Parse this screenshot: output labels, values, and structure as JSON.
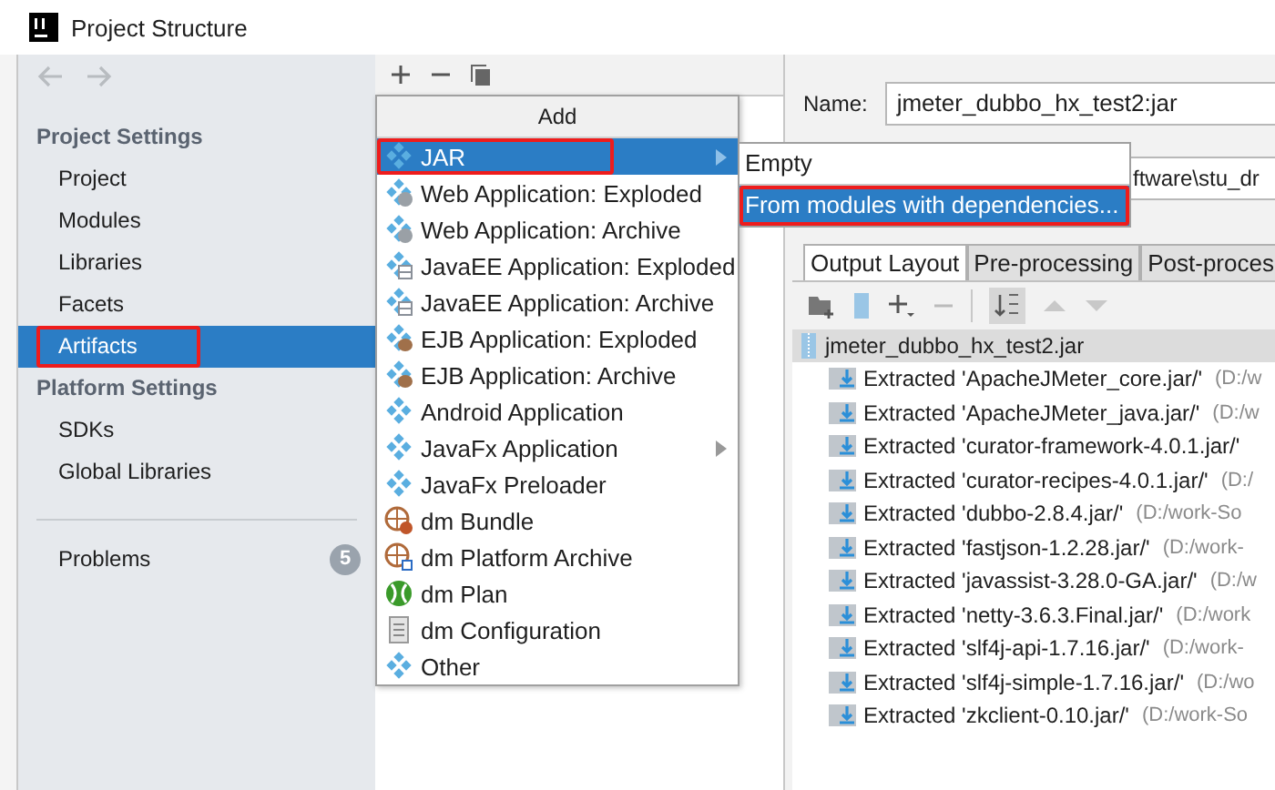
{
  "window": {
    "title": "Project Structure"
  },
  "sidebar": {
    "sections": [
      {
        "title": "Project Settings",
        "items": [
          {
            "label": "Project",
            "selected": false,
            "annotated": false
          },
          {
            "label": "Modules",
            "selected": false,
            "annotated": false
          },
          {
            "label": "Libraries",
            "selected": false,
            "annotated": false
          },
          {
            "label": "Facets",
            "selected": false,
            "annotated": false
          },
          {
            "label": "Artifacts",
            "selected": true,
            "annotated": true
          }
        ]
      },
      {
        "title": "Platform Settings",
        "items": [
          {
            "label": "SDKs",
            "selected": false,
            "annotated": false
          },
          {
            "label": "Global Libraries",
            "selected": false,
            "annotated": false
          }
        ]
      }
    ],
    "problems": {
      "label": "Problems",
      "count": "5"
    }
  },
  "add_menu": {
    "title": "Add",
    "items": [
      {
        "label": "JAR",
        "kind": "diamond",
        "selected": true,
        "submenu": true,
        "annotated": true
      },
      {
        "label": "Web Application: Exploded",
        "kind": "web",
        "selected": false,
        "submenu": false,
        "annotated": false
      },
      {
        "label": "Web Application: Archive",
        "kind": "web",
        "selected": false,
        "submenu": false,
        "annotated": false
      },
      {
        "label": "JavaEE Application: Exploded",
        "kind": "javaee",
        "selected": false,
        "submenu": false,
        "annotated": false
      },
      {
        "label": "JavaEE Application: Archive",
        "kind": "javaee",
        "selected": false,
        "submenu": false,
        "annotated": false
      },
      {
        "label": "EJB Application: Exploded",
        "kind": "ejb",
        "selected": false,
        "submenu": false,
        "annotated": false
      },
      {
        "label": "EJB Application: Archive",
        "kind": "ejb",
        "selected": false,
        "submenu": false,
        "annotated": false
      },
      {
        "label": "Android Application",
        "kind": "diamond",
        "selected": false,
        "submenu": false,
        "annotated": false
      },
      {
        "label": "JavaFx Application",
        "kind": "diamond",
        "selected": false,
        "submenu": true,
        "annotated": false
      },
      {
        "label": "JavaFx Preloader",
        "kind": "diamond",
        "selected": false,
        "submenu": false,
        "annotated": false
      },
      {
        "label": "dm Bundle",
        "kind": "bundle",
        "selected": false,
        "submenu": false,
        "annotated": false
      },
      {
        "label": "dm Platform Archive",
        "kind": "platform",
        "selected": false,
        "submenu": false,
        "annotated": false
      },
      {
        "label": "dm Plan",
        "kind": "plan",
        "selected": false,
        "submenu": false,
        "annotated": false
      },
      {
        "label": "dm Configuration",
        "kind": "config",
        "selected": false,
        "submenu": false,
        "annotated": false
      },
      {
        "label": "Other",
        "kind": "diamond",
        "selected": false,
        "submenu": false,
        "annotated": false
      }
    ]
  },
  "jar_submenu": {
    "items": [
      {
        "label": "Empty",
        "selected": false,
        "annotated": false
      },
      {
        "label": "From modules with dependencies...",
        "selected": true,
        "annotated": true
      }
    ]
  },
  "artifact": {
    "name_label": "Name:",
    "name_value": "jmeter_dubbo_hx_test2:jar",
    "output_value": "ftware\\stu_dr",
    "tabs": [
      {
        "label": "Output Layout",
        "selected": true
      },
      {
        "label": "Pre-processing",
        "selected": false
      },
      {
        "label": "Post-proces",
        "selected": false
      }
    ],
    "tree": {
      "root": "jmeter_dubbo_hx_test2.jar",
      "children": [
        {
          "label": "Extracted 'ApacheJMeter_core.jar/'",
          "path": "(D:/w"
        },
        {
          "label": "Extracted 'ApacheJMeter_java.jar/'",
          "path": "(D:/w"
        },
        {
          "label": "Extracted 'curator-framework-4.0.1.jar/'"
        },
        {
          "label": "Extracted 'curator-recipes-4.0.1.jar/'",
          "path": "(D:/"
        },
        {
          "label": "Extracted 'dubbo-2.8.4.jar/'",
          "path": "(D:/work-So"
        },
        {
          "label": "Extracted 'fastjson-1.2.28.jar/'",
          "path": "(D:/work-"
        },
        {
          "label": "Extracted 'javassist-3.28.0-GA.jar/'",
          "path": "(D:/w"
        },
        {
          "label": "Extracted 'netty-3.6.3.Final.jar/'",
          "path": "(D:/work"
        },
        {
          "label": "Extracted 'slf4j-api-1.7.16.jar/'",
          "path": "(D:/work-"
        },
        {
          "label": "Extracted 'slf4j-simple-1.7.16.jar/'",
          "path": "(D:/wo"
        },
        {
          "label": "Extracted 'zkclient-0.10.jar/'",
          "path": "(D:/work-So"
        }
      ]
    }
  }
}
